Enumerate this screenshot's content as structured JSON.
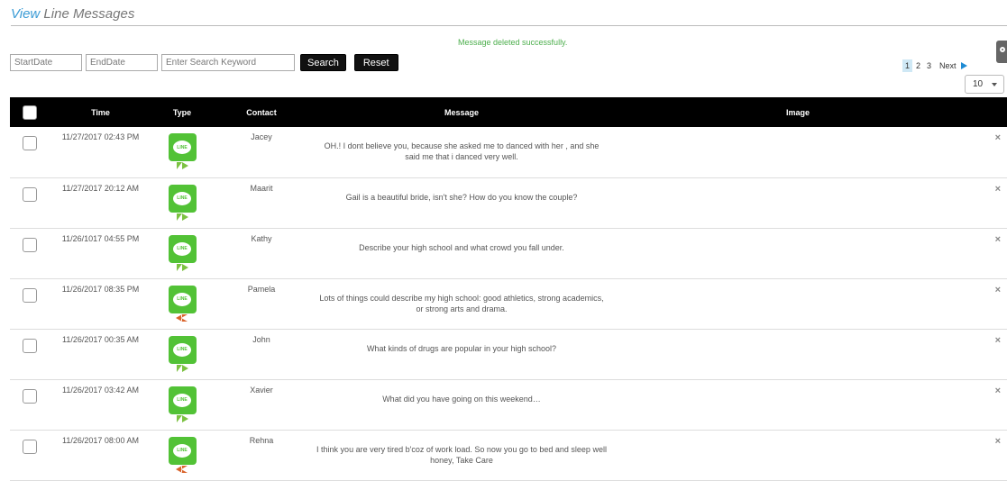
{
  "header": {
    "title_accent": "View",
    "title_rest": "Line Messages"
  },
  "flash_message": "Message deleted successfully.",
  "filters": {
    "start_placeholder": "StartDate",
    "end_placeholder": "EndDate",
    "keyword_placeholder": "Enter Search Keyword",
    "search_label": "Search",
    "reset_label": "Reset"
  },
  "pagination": {
    "page1": "1",
    "page2": "2",
    "page3": "3",
    "next": "Next"
  },
  "page_size": "10",
  "table": {
    "headers": {
      "time": "Time",
      "type": "Type",
      "contact": "Contact",
      "message": "Message",
      "image": "Image"
    },
    "rows": [
      {
        "time": "11/27/2017 02:43 PM",
        "type": "LINE",
        "direction": "outgoing",
        "contact": "Jacey",
        "message": "OH.! I dont believe you, because she asked me to danced with her , and she said me that i danced very well.",
        "delete": "×"
      },
      {
        "time": "11/27/2017 20:12 AM",
        "type": "LINE",
        "direction": "outgoing",
        "contact": "Maarit",
        "message": "Gail is a beautiful bride, isn't she? How do you know the couple?",
        "delete": "×"
      },
      {
        "time": "11/26/1017 04:55 PM",
        "type": "LINE",
        "direction": "outgoing",
        "contact": "Kathy",
        "message": "Describe your high school and what crowd you fall under.",
        "delete": "×"
      },
      {
        "time": "11/26/2017 08:35 PM",
        "type": "LINE",
        "direction": "incoming",
        "contact": "Pamela",
        "message": "Lots of things could describe my high school: good athletics, strong academics, or strong arts and drama.",
        "delete": "×"
      },
      {
        "time": "11/26/2017 00:35 AM",
        "type": "LINE",
        "direction": "outgoing",
        "contact": "John",
        "message": "What kinds of drugs are popular in your high school?",
        "delete": "×"
      },
      {
        "time": "11/26/2017 03:42 AM",
        "type": "LINE",
        "direction": "outgoing",
        "contact": "Xavier",
        "message": "What did you have going on this weekend…",
        "delete": "×"
      },
      {
        "time": "11/26/2017 08:00 AM",
        "type": "LINE",
        "direction": "incoming",
        "contact": "Rehna",
        "message": "I think you are very tired b'coz of work load. So now you go to bed and sleep well honey, Take Care",
        "delete": "×"
      }
    ]
  },
  "colors": {
    "accent": "#3a9bd5",
    "success": "#4cae4c",
    "line_green": "#52c236",
    "outgoing_arrow": "#7cc242",
    "incoming_arrow": "#d9632b"
  }
}
